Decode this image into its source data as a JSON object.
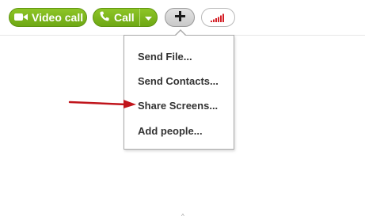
{
  "toolbar": {
    "video_call_label": "Video call",
    "call_label": "Call",
    "plus_label": "+",
    "dropdown_arrow": "▾",
    "colors": {
      "call_green": "#7ab51d",
      "signal_red": "#d42027"
    }
  },
  "menu": {
    "items": [
      {
        "label": "Send File..."
      },
      {
        "label": "Send Contacts..."
      },
      {
        "label": "Share Screens..."
      },
      {
        "label": "Add people..."
      }
    ]
  },
  "annotation": {
    "arrow_color": "#c0141b",
    "target_item": "Share Screens..."
  },
  "icons": {
    "video": "video-camera-icon",
    "call": "phone-icon",
    "plus": "plus-icon",
    "signal": "signal-strength-icon"
  },
  "footer": {
    "caret_glyph": "^"
  }
}
